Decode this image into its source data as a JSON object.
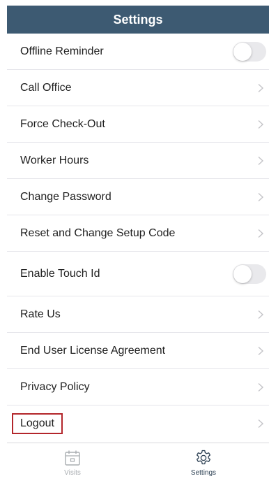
{
  "header": {
    "title": "Settings"
  },
  "settings": {
    "items": [
      {
        "label": "Offline Reminder",
        "control": "toggle",
        "checked": false
      },
      {
        "label": "Call Office",
        "control": "chevron"
      },
      {
        "label": "Force Check-Out",
        "control": "chevron"
      },
      {
        "label": "Worker Hours",
        "control": "chevron"
      },
      {
        "label": "Change Password",
        "control": "chevron"
      },
      {
        "label": "Reset and Change Setup Code",
        "control": "chevron"
      },
      {
        "label": "Enable Touch Id",
        "control": "toggle",
        "checked": false
      },
      {
        "label": "Rate Us",
        "control": "chevron"
      },
      {
        "label": "End User License Agreement",
        "control": "chevron"
      },
      {
        "label": "Privacy Policy",
        "control": "chevron"
      },
      {
        "label": "Logout",
        "control": "chevron",
        "highlighted": true
      }
    ]
  },
  "tabbar": {
    "tabs": [
      {
        "label": "Visits",
        "icon": "calendar-icon",
        "active": false
      },
      {
        "label": "Settings",
        "icon": "gear-icon",
        "active": true
      }
    ]
  },
  "colors": {
    "navbar_bg": "#3d5a72",
    "highlight_border": "#b3262b",
    "toggle_off": "#e9e9ec",
    "tab_active": "#2b3f52",
    "tab_inactive": "#a9adb1"
  }
}
